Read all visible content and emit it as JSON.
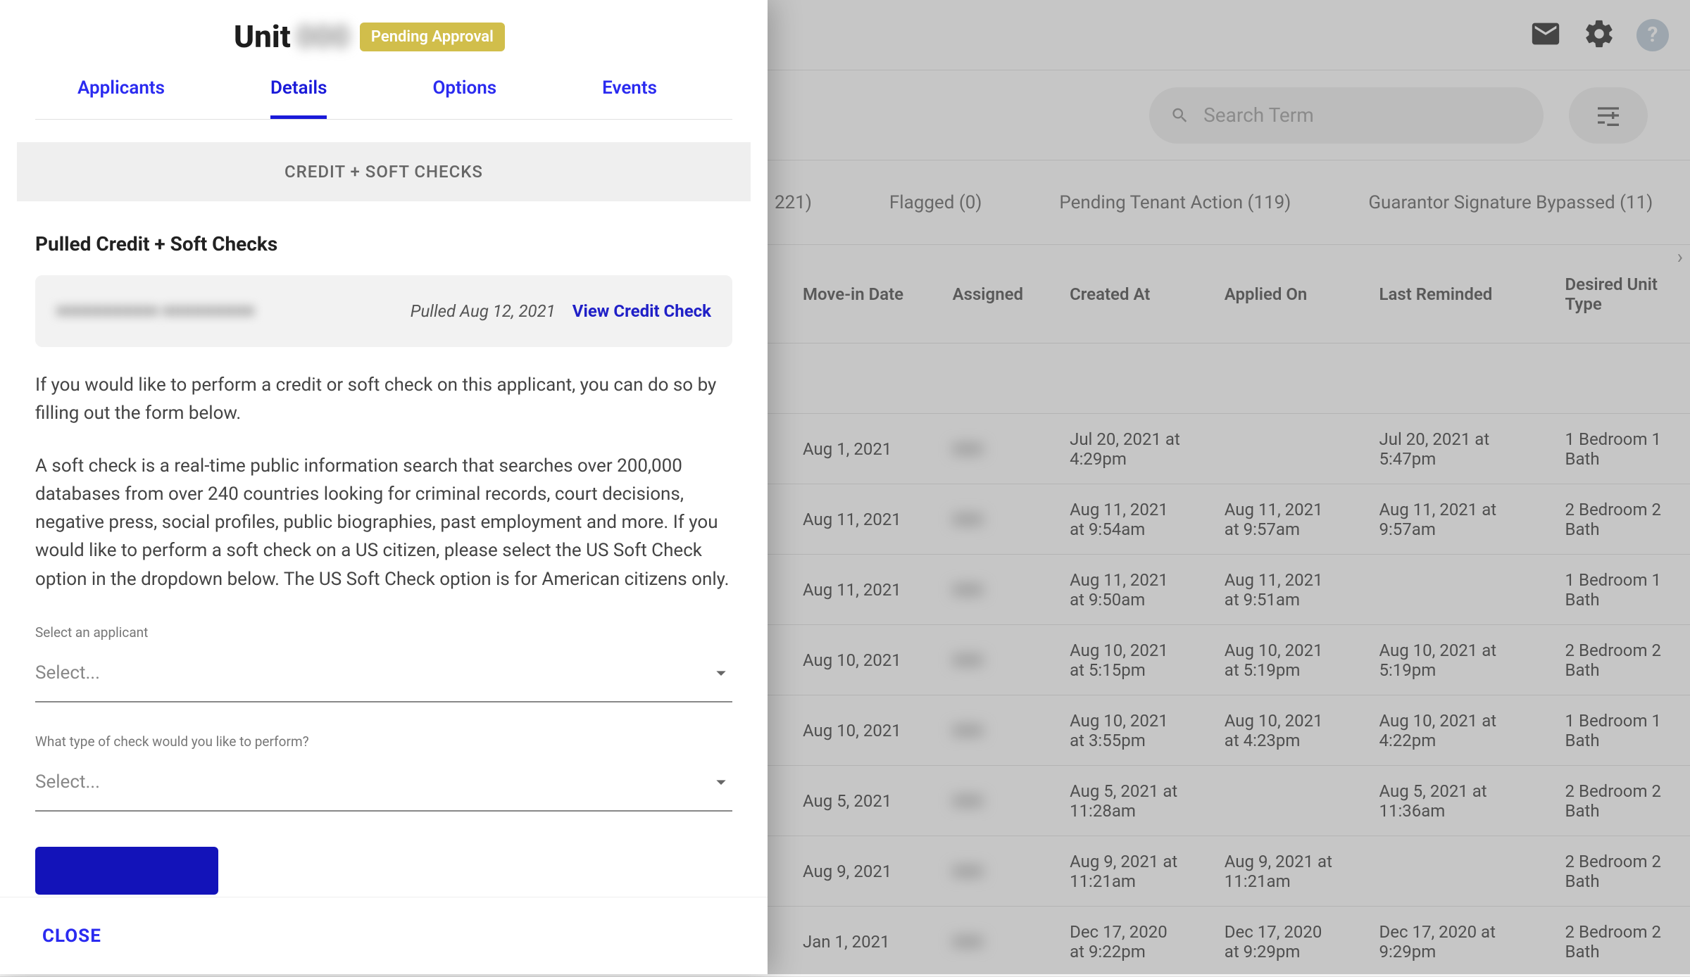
{
  "topbar": {
    "help_glyph": "?"
  },
  "search": {
    "placeholder": "Search Term"
  },
  "filters": {
    "count_suffix": "221)",
    "flagged": "Flagged (0)",
    "pending": "Pending Tenant Action (119)",
    "guarantor": "Guarantor Signature Bypassed (11)"
  },
  "columns": {
    "move": "Move-in Date",
    "assigned": "Assigned",
    "created": "Created At",
    "applied": "Applied On",
    "reminded": "Last Reminded",
    "desired": "Desired Unit Type"
  },
  "rows": [
    {
      "move": "Aug 1, 2021",
      "assigned": "■■■",
      "created": "Jul 20, 2021 at 4:29pm",
      "applied": "",
      "reminded": "Jul 20, 2021 at 5:47pm",
      "desired": "1 Bedroom 1 Bath"
    },
    {
      "move": "Aug 11, 2021",
      "assigned": "■■■",
      "created": "Aug 11, 2021 at 9:54am",
      "applied": "Aug 11, 2021 at 9:57am",
      "reminded": "Aug 11, 2021 at 9:57am",
      "desired": "2 Bedroom 2 Bath"
    },
    {
      "move": "Aug 11, 2021",
      "assigned": "■■■",
      "created": "Aug 11, 2021 at 9:50am",
      "applied": "Aug 11, 2021 at 9:51am",
      "reminded": "",
      "desired": "1 Bedroom 1 Bath"
    },
    {
      "move": "Aug 10, 2021",
      "assigned": "■■■",
      "created": "Aug 10, 2021 at 5:15pm",
      "applied": "Aug 10, 2021 at 5:19pm",
      "reminded": "Aug 10, 2021 at 5:19pm",
      "desired": "2 Bedroom 2 Bath"
    },
    {
      "move": "Aug 10, 2021",
      "assigned": "■■■",
      "created": "Aug 10, 2021 at 3:55pm",
      "applied": "Aug 10, 2021 at 4:23pm",
      "reminded": "Aug 10, 2021 at 4:22pm",
      "desired": "1 Bedroom 1 Bath"
    },
    {
      "move": "Aug 5, 2021",
      "assigned": "■■■",
      "created": "Aug 5, 2021 at 11:28am",
      "applied": "",
      "reminded": "Aug 5, 2021 at 11:36am",
      "desired": "2 Bedroom 2 Bath"
    },
    {
      "move": "Aug 9, 2021",
      "assigned": "■■■",
      "created": "Aug 9, 2021 at 11:21am",
      "applied": "Aug 9, 2021 at 11:21am",
      "reminded": "",
      "desired": "2 Bedroom 2 Bath"
    },
    {
      "move": "Jan 1, 2021",
      "assigned": "■■■",
      "created": "Dec 17, 2020 at 9:22pm",
      "applied": "Dec 17, 2020 at 9:29pm",
      "reminded": "Dec 17, 2020 at 9:29pm",
      "desired": "2 Bedroom 2 Bath"
    }
  ],
  "panel": {
    "unit_label": "Unit",
    "unit_number": "000",
    "status": "Pending Approval",
    "tabs": {
      "applicants": "Applicants",
      "details": "Details",
      "options": "Options",
      "events": "Events"
    },
    "section_header": "CREDIT + SOFT CHECKS",
    "pulled_heading": "Pulled Credit + Soft Checks",
    "check": {
      "name": "■■■■■■■■■■ ■■■■■■■■■",
      "date": "Pulled Aug 12, 2021",
      "link": "View Credit Check"
    },
    "para1": "If you would like to perform a credit or soft check on this applicant, you can do so by filling out the form below.",
    "para2": "A soft check is a real-time public information search that searches over 200,000 databases from over 240 countries looking for criminal records, court decisions, negative press, social profiles, public biographies, past employment and more. If you would like to perform a soft check on a US citizen, please select the US Soft Check option in the dropdown below. The US Soft Check option is for American citizens only.",
    "select_applicant_label": "Select an applicant",
    "select_placeholder": "Select...",
    "check_type_label": "What type of check would you like to perform?",
    "close": "CLOSE"
  }
}
